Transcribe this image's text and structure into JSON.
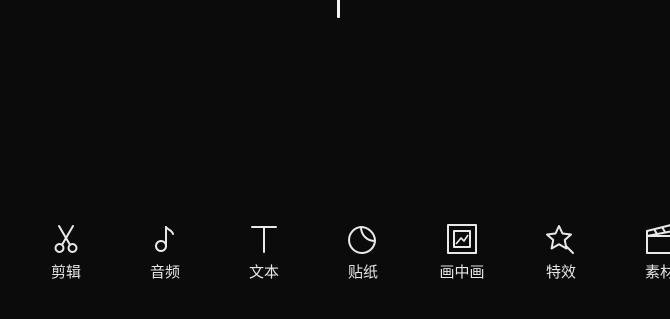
{
  "toolbar": {
    "items": [
      {
        "label": "剪辑",
        "icon": "scissors-icon"
      },
      {
        "label": "音频",
        "icon": "music-note-icon"
      },
      {
        "label": "文本",
        "icon": "text-t-icon"
      },
      {
        "label": "贴纸",
        "icon": "sticker-icon"
      },
      {
        "label": "画中画",
        "icon": "picture-in-picture-icon"
      },
      {
        "label": "特效",
        "icon": "effects-star-icon"
      },
      {
        "label": "素材",
        "icon": "material-clapper-icon"
      }
    ]
  },
  "colors": {
    "background": "#0b0b0c",
    "icon": "#e9e9e9",
    "playhead": "#f2f2f2"
  }
}
